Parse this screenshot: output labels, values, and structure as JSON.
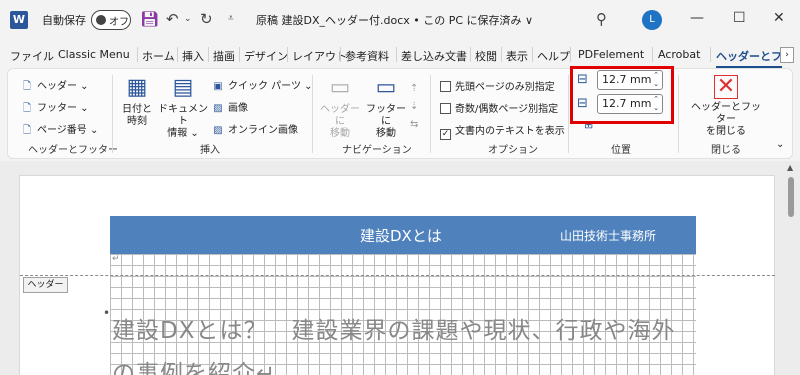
{
  "titlebar": {
    "app_logo": "W",
    "autosave_label": "自動保存",
    "autosave_state": "オフ",
    "document_title": "原稿 建設DX_ヘッダー付.docx • この PC に保存済み ∨",
    "avatar_initial": "L",
    "icons": [
      "word-icon",
      "save-icon",
      "undo-icon",
      "redo-icon",
      "search-icon",
      "minimize-icon",
      "maximize-icon",
      "close-icon"
    ]
  },
  "tabs": [
    "ファイル",
    "Classic Menu",
    "ホーム",
    "挿入",
    "描画",
    "デザイン",
    "レイアウト",
    "参考資料",
    "差し込み文書",
    "校閲",
    "表示",
    "ヘルプ",
    "PDFelement",
    "Acrobat",
    "ヘッダーとフ"
  ],
  "active_tab": "ヘッダーとフ",
  "ribbon": {
    "header_footer": {
      "header_label": "ヘッダー",
      "footer_label": "フッター",
      "page_number_label": "ページ番号",
      "group_label": "ヘッダーとフッター"
    },
    "insert": {
      "datetime_label_1": "日付と",
      "datetime_label_2": "時刻",
      "docinfo_label_1": "ドキュメント",
      "docinfo_label_2": "情報",
      "quickparts_label": "クイック パーツ",
      "picture_label": "画像",
      "online_picture_label": "オンライン画像",
      "group_label": "挿入"
    },
    "navigation": {
      "goto_header_1": "ヘッダーに",
      "goto_header_2": "移動",
      "goto_footer_1": "フッターに",
      "goto_footer_2": "移動",
      "group_label": "ナビゲーション"
    },
    "options": {
      "first_page_label": "先頭ページのみ別指定",
      "odd_even_label": "奇数/偶数ページ別指定",
      "show_text_label": "文書内のテキストを表示",
      "show_text_checked": "✓",
      "group_label": "オプション"
    },
    "position": {
      "header_from_top": "12.7 mm",
      "footer_from_bottom": "12.7 mm",
      "group_label": "位置"
    },
    "close": {
      "close_label_1": "ヘッダーとフッター",
      "close_label_2": "を閉じる",
      "group_label": "閉じる"
    }
  },
  "document": {
    "header_title": "建設DXとは",
    "header_office": "山田技術士事務所",
    "header_tag": "ヘッダー",
    "return_mark": "↵",
    "body_line_1": "建設DXとは？　建設業界の課題や現状、行政や海外",
    "body_line_2": "の事例を紹介↵"
  },
  "colors": {
    "header_band": "#4f81bd",
    "highlight_box": "#e00000",
    "active_tab": "#1c4e8c"
  }
}
